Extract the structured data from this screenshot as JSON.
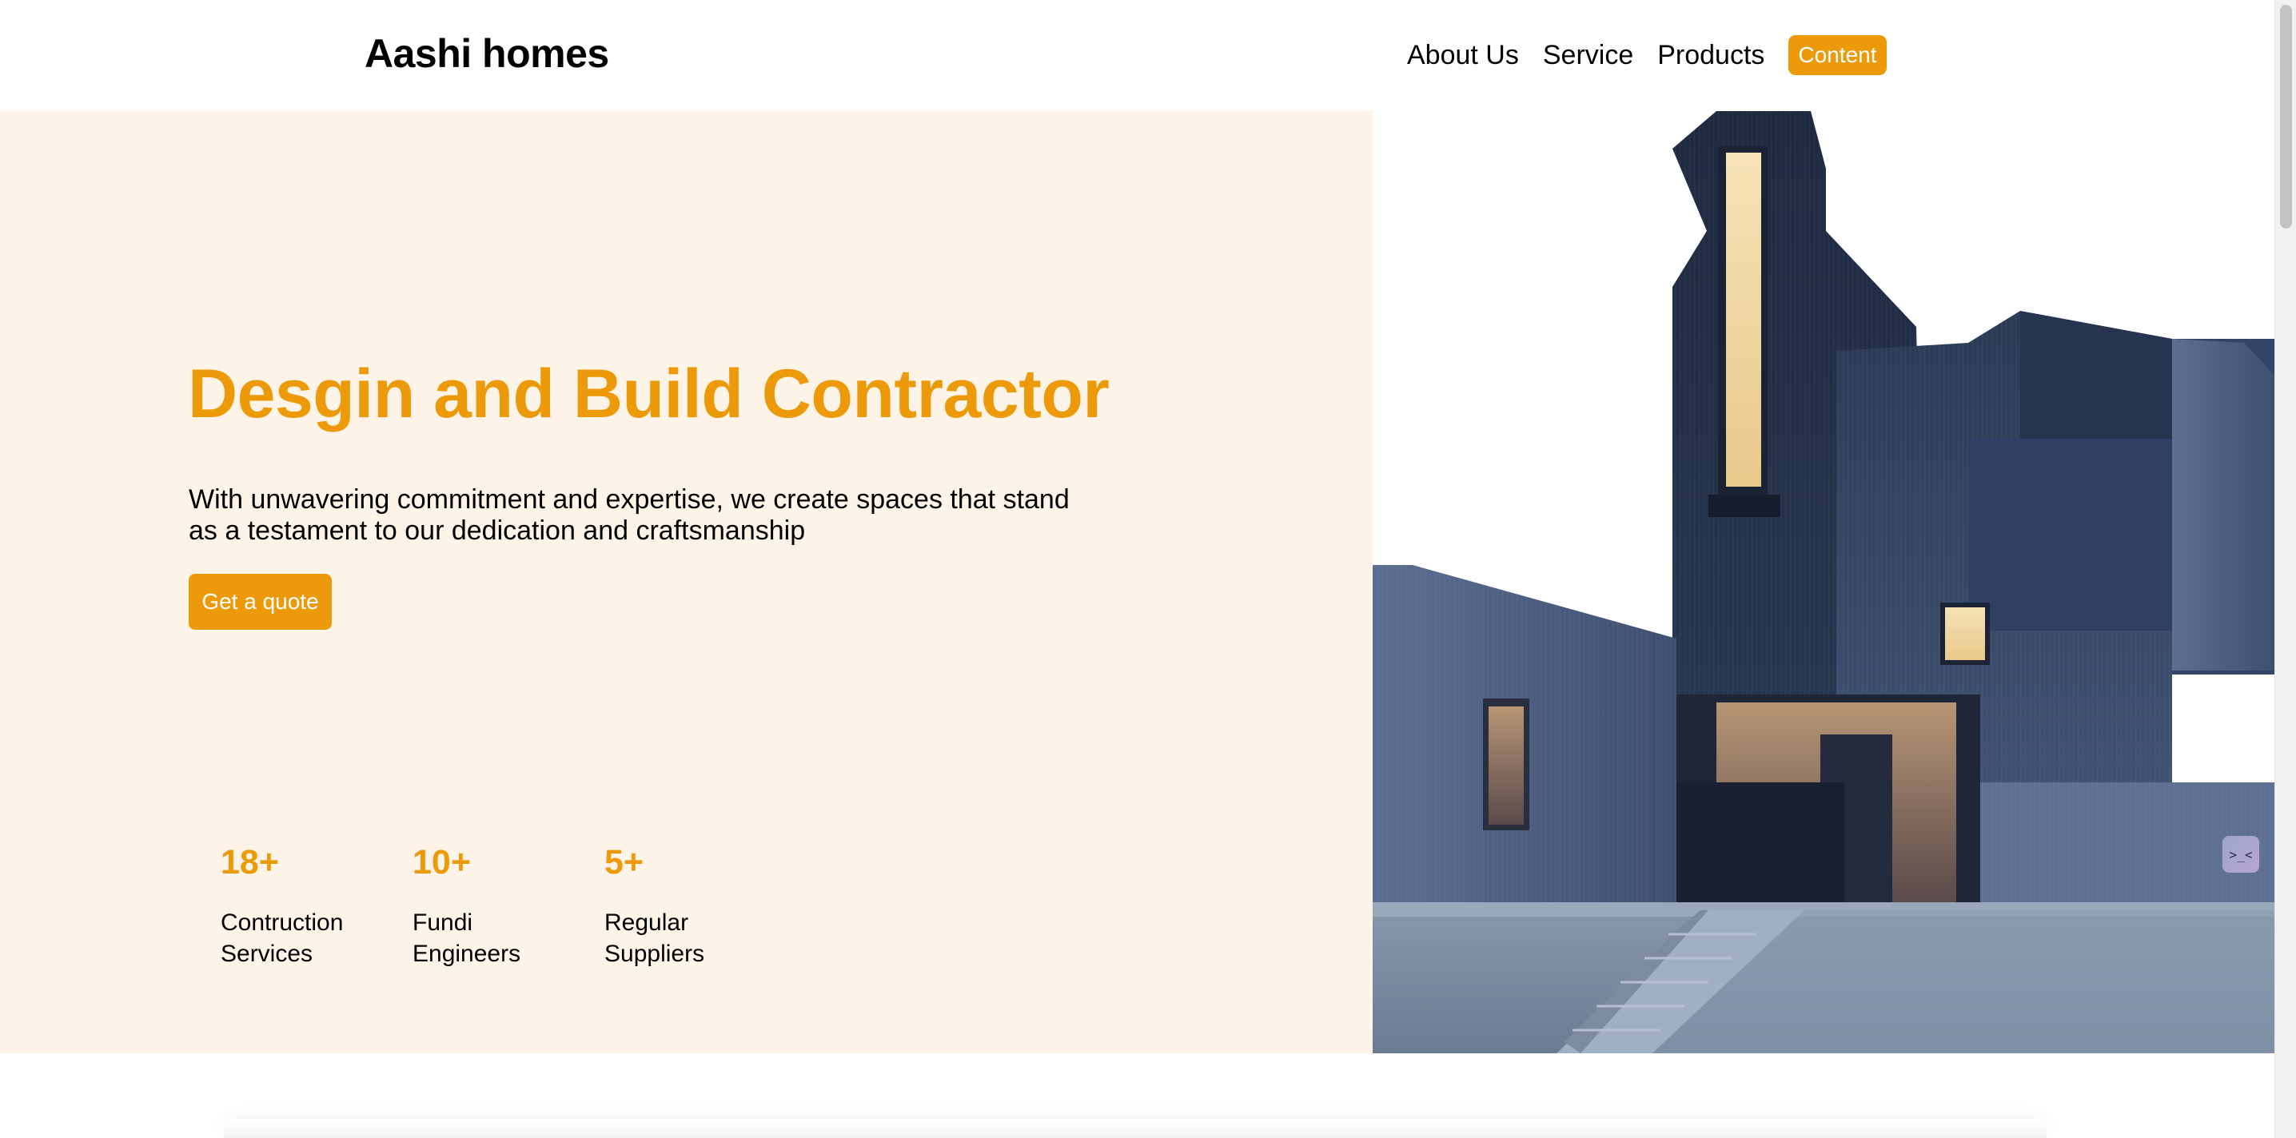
{
  "header": {
    "logo": "Aashi homes",
    "nav": [
      {
        "label": "About Us"
      },
      {
        "label": "Service"
      },
      {
        "label": "Products"
      }
    ],
    "cta_label": "Content"
  },
  "hero": {
    "title": "Desgin and Build Contractor",
    "description": "With unwavering commitment and expertise, we create spaces that stand as a testament to our dedication and craftsmanship",
    "button_label": "Get a quote",
    "stats": [
      {
        "value": "18+",
        "label": "Contruction Services"
      },
      {
        "value": "10+",
        "label": "Fundi Engineers"
      },
      {
        "value": "5+",
        "label": "Regular Suppliers"
      }
    ]
  },
  "widget": {
    "glyph": ">_<"
  },
  "colors": {
    "accent": "#ec9a0a",
    "hero_background": "#fdf4e7",
    "header_background": "#ffffff"
  }
}
